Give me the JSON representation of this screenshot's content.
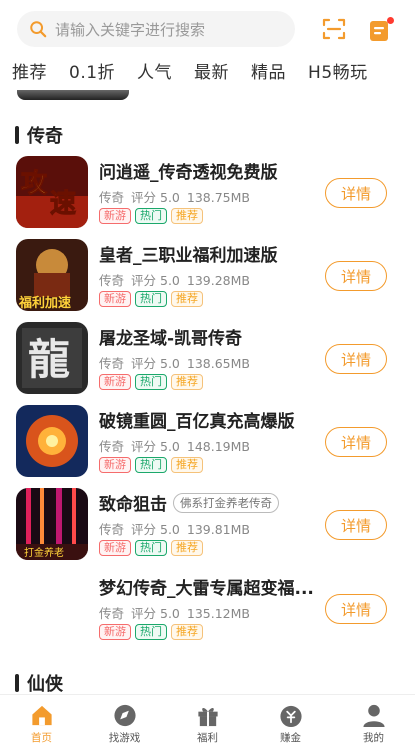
{
  "search": {
    "placeholder": "请输入关键字进行搜索"
  },
  "tabs": [
    "推荐",
    "0.1折",
    "人气",
    "最新",
    "精品",
    "H5畅玩"
  ],
  "sections": [
    {
      "title": "传奇",
      "games": [
        {
          "name": "问逍遥_传奇透视免费版",
          "desc_tag": "",
          "category": "传奇",
          "rating": "评分 5.0",
          "size": "138.75MB",
          "tags": [
            "新游",
            "热门",
            "推荐"
          ],
          "button": "详情"
        },
        {
          "name": "皇者_三职业福利加速版",
          "desc_tag": "",
          "category": "传奇",
          "rating": "评分 5.0",
          "size": "139.28MB",
          "tags": [
            "新游",
            "热门",
            "推荐"
          ],
          "button": "详情"
        },
        {
          "name": "屠龙圣域-凯哥传奇",
          "desc_tag": "",
          "category": "传奇",
          "rating": "评分 5.0",
          "size": "138.65MB",
          "tags": [
            "新游",
            "热门",
            "推荐"
          ],
          "button": "详情"
        },
        {
          "name": "破镜重圆_百亿真充高爆版",
          "desc_tag": "",
          "category": "传奇",
          "rating": "评分 5.0",
          "size": "148.19MB",
          "tags": [
            "新游",
            "热门",
            "推荐"
          ],
          "button": "详情"
        },
        {
          "name": "致命狙击",
          "desc_tag": "佛系打金养老传奇",
          "category": "传奇",
          "rating": "评分 5.0",
          "size": "139.81MB",
          "tags": [
            "新游",
            "热门",
            "推荐"
          ],
          "button": "详情"
        },
        {
          "name": "梦幻传奇_大雷专属超变福...",
          "desc_tag": "",
          "category": "传奇",
          "rating": "评分 5.0",
          "size": "135.12MB",
          "tags": [
            "新游",
            "热门",
            "推荐"
          ],
          "button": "详情"
        }
      ]
    },
    {
      "title": "仙侠",
      "games": []
    }
  ],
  "bottom_nav": [
    {
      "label": "首页",
      "icon": "home-icon",
      "active": true
    },
    {
      "label": "找游戏",
      "icon": "compass-icon",
      "active": false
    },
    {
      "label": "福利",
      "icon": "gift-icon",
      "active": false
    },
    {
      "label": "赚金",
      "icon": "money-bag-icon",
      "active": false
    },
    {
      "label": "我的",
      "icon": "user-icon",
      "active": false
    }
  ],
  "colors": {
    "accent": "#f39b2d",
    "badge_new": "#f56c6c",
    "badge_hot": "#1ba86b",
    "badge_rec": "#f5a623",
    "notification_dot": "#ff3b30"
  }
}
